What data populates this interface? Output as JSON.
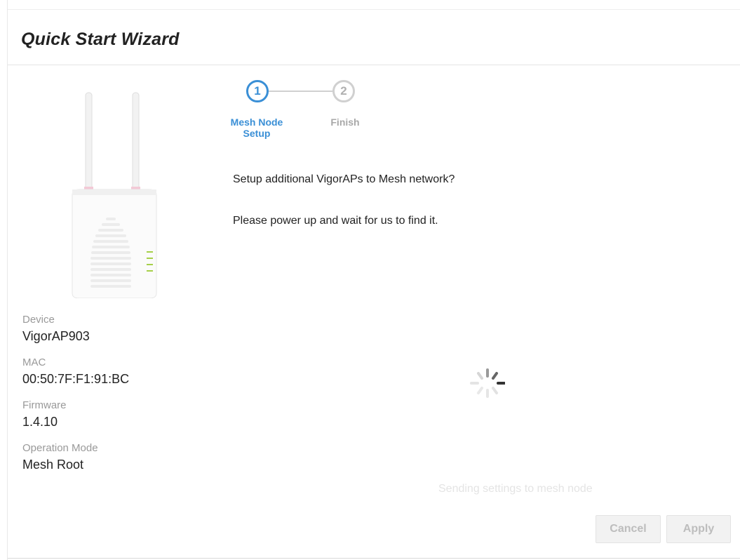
{
  "wizard": {
    "title": "Quick Start Wizard"
  },
  "steps": [
    {
      "number": "1",
      "label": "Mesh Node Setup",
      "state": "active"
    },
    {
      "number": "2",
      "label": "Finish",
      "state": "inactive"
    }
  ],
  "messages": {
    "prompt": "Setup additional VigorAPs to Mesh network?",
    "instruction": "Please power up and wait for us to find it."
  },
  "device_info": {
    "device_label": "Device",
    "device_value": "VigorAP903",
    "mac_label": "MAC",
    "mac_value": "00:50:7F:F1:91:BC",
    "firmware_label": "Firmware",
    "firmware_value": "1.4.10",
    "mode_label": "Operation Mode",
    "mode_value": "Mesh Root"
  },
  "status": {
    "text": "Sending settings to mesh node"
  },
  "buttons": {
    "cancel": "Cancel",
    "apply": "Apply"
  },
  "colors": {
    "accent": "#3a8fd6",
    "inactive": "#b0b0b0",
    "disabled_text": "#bdbdbd"
  }
}
